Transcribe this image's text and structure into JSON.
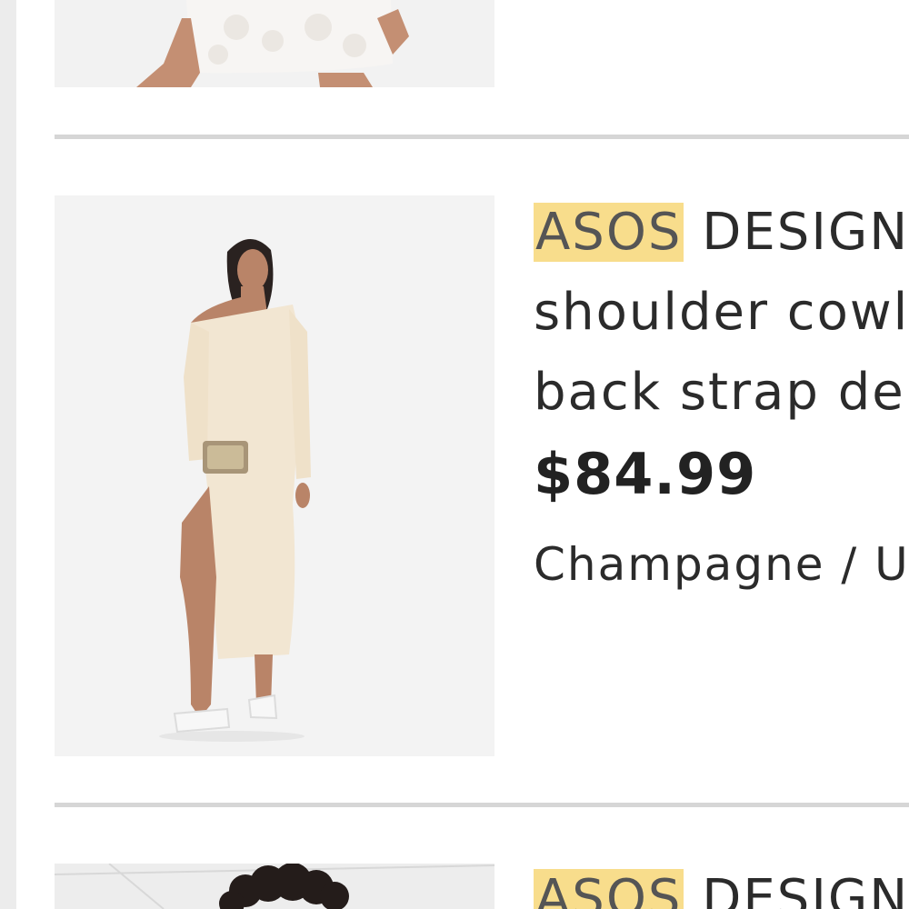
{
  "products": [
    {
      "image_alt": "",
      "title_brand": "",
      "title_lines": [],
      "price": "",
      "variant": ""
    },
    {
      "image_alt": "",
      "title_brand": "ASOS",
      "title_lines": [
        "DESIGN",
        "shoulder cowl",
        "back strap de"
      ],
      "price": "$84.99",
      "variant": "Champagne / U"
    },
    {
      "image_alt": "",
      "title_brand": "ASOS",
      "title_lines": [
        "DESIGN"
      ],
      "price": "",
      "variant": ""
    }
  ],
  "colors": {
    "brand_highlight": "#f8dd8c",
    "divider": "#d6d6d6",
    "rail": "#ececec",
    "dress_champagne": "#f2e6d2"
  }
}
